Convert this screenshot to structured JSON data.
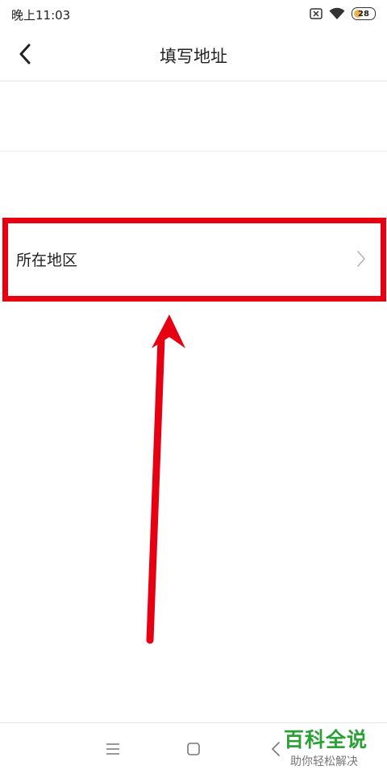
{
  "status_bar": {
    "time": "晚上11:03",
    "battery": "28"
  },
  "header": {
    "title": "填写地址"
  },
  "form": {
    "region_label": "所在地区"
  },
  "watermark": {
    "title": "百科全说",
    "subtitle": "助你轻松解决"
  },
  "colors": {
    "highlight": "#e60012",
    "watermark_green": "#2aa036",
    "battery_fill": "#e9b44c"
  },
  "icons": [
    "back-arrow-icon",
    "chevron-right-icon",
    "sim-icon",
    "wifi-icon",
    "battery-icon",
    "menu-icon",
    "home-icon",
    "nav-back-icon",
    "pointer-arrow"
  ]
}
